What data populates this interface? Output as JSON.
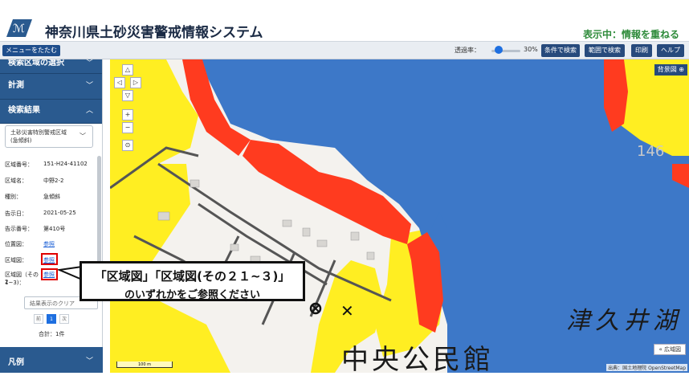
{
  "header": {
    "title": "神奈川県土砂災害警戒情報システム",
    "mode": "表示中：情報を重ねる"
  },
  "toolbar": {
    "collapse_menu": "メニューをたたむ",
    "opacity_label": "透過率：",
    "opacity_value": "30%",
    "buttons": [
      "条件で検索",
      "範囲で検索",
      "印刷",
      "ヘルプ"
    ]
  },
  "sidebar": {
    "section_area_select": "検索区域の選択",
    "section_measure": "計測",
    "section_results": "検索結果",
    "select_line1": "土砂災害特別警戒区域",
    "select_line2": "(急傾斜)",
    "details": [
      {
        "key": "区域番号：",
        "value": "151-H24-41102"
      },
      {
        "key": "区域名：",
        "value": "中野2-2"
      },
      {
        "key": "種別：",
        "value": "急傾斜"
      },
      {
        "key": "告示日：",
        "value": "2021-05-25"
      },
      {
        "key": "告示番号：",
        "value": "第410号"
      },
      {
        "key": "位置図：",
        "value": "参照"
      },
      {
        "key": "区域図：",
        "value": "参照"
      },
      {
        "key": "区域図（その2",
        "value": "参照"
      }
    ],
    "detail_extra": "1~3)：",
    "clear_results": "結果表示のクリア",
    "pager": [
      "前",
      "1",
      "次"
    ],
    "total": "合計：1件",
    "legend": "凡例"
  },
  "map": {
    "background_button": "背景図 ⊕",
    "wide_button": "« 広域図",
    "attribution": "出典：国土地理院 OpenStreetMap",
    "scale": "100 m",
    "lake_label": "津久井湖",
    "hall_label": "中央公民館",
    "elevation": "146",
    "colors": {
      "water": "#3d78c8",
      "red_zone": "#ff3b1f",
      "yellow_zone": "#ffee22"
    }
  },
  "callout": {
    "line1": "「区域図」「区域図(その２１~３)」",
    "line2": "のいずれかをご参照ください"
  }
}
